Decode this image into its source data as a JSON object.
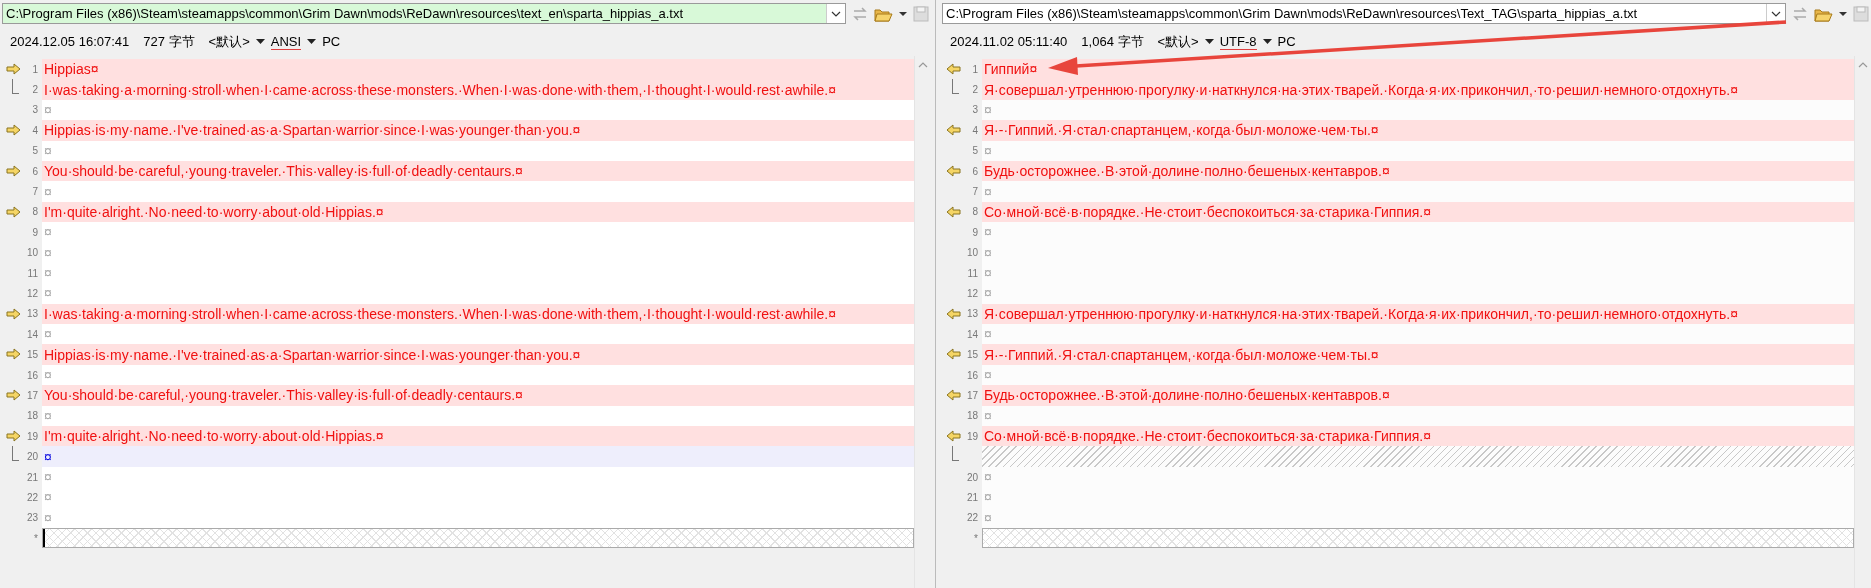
{
  "panes": [
    {
      "path": {
        "value": "C:\\Program Files (x86)\\Steam\\steamapps\\common\\Grim Dawn\\mods\\ReDawn\\resources\\text_en\\sparta_hippias_a.txt",
        "highlighted": true
      },
      "info": {
        "timestamp": "2024.12.05 16:07:41",
        "size": "727 字节",
        "format": "<默认>",
        "encoding": "ANSI",
        "line_endings": "PC"
      },
      "rows": [
        {
          "num": "1",
          "kind": "diff",
          "arrow": true,
          "bracket": false,
          "text": "Hippias¤"
        },
        {
          "num": "2",
          "kind": "diff",
          "arrow": false,
          "bracket": true,
          "text": "I·was·taking·a·morning·stroll·when·I·came·across·these·monsters.·When·I·was·done·with·them,·I·thought·I·would·rest·awhile.¤"
        },
        {
          "num": "3",
          "kind": "blank",
          "arrow": false,
          "bracket": false,
          "text": "¤"
        },
        {
          "num": "4",
          "kind": "diff",
          "arrow": true,
          "bracket": false,
          "text": "Hippias·is·my·name.·I've·trained·as·a·Spartan·warrior·since·I·was·younger·than·you.¤"
        },
        {
          "num": "5",
          "kind": "blank",
          "arrow": false,
          "bracket": false,
          "text": "¤"
        },
        {
          "num": "6",
          "kind": "diff",
          "arrow": true,
          "bracket": false,
          "text": "You·should·be·careful,·young·traveler.·This·valley·is·full·of·deadly·centaurs.¤"
        },
        {
          "num": "7",
          "kind": "blank",
          "arrow": false,
          "bracket": false,
          "text": "¤"
        },
        {
          "num": "8",
          "kind": "diff",
          "arrow": true,
          "bracket": false,
          "text": "I'm·quite·alright.·No·need·to·worry·about·old·Hippias.¤"
        },
        {
          "num": "9",
          "kind": "blank",
          "arrow": false,
          "bracket": false,
          "text": "¤"
        },
        {
          "num": "10",
          "kind": "blank",
          "arrow": false,
          "bracket": false,
          "text": "¤"
        },
        {
          "num": "11",
          "kind": "blank",
          "arrow": false,
          "bracket": false,
          "text": "¤"
        },
        {
          "num": "12",
          "kind": "blank",
          "arrow": false,
          "bracket": false,
          "text": "¤"
        },
        {
          "num": "13",
          "kind": "diff",
          "arrow": true,
          "bracket": false,
          "text": "I·was·taking·a·morning·stroll·when·I·came·across·these·monsters.·When·I·was·done·with·them,·I·thought·I·would·rest·awhile.¤"
        },
        {
          "num": "14",
          "kind": "blank",
          "arrow": false,
          "bracket": false,
          "text": "¤"
        },
        {
          "num": "15",
          "kind": "diff",
          "arrow": true,
          "bracket": false,
          "text": "Hippias·is·my·name.·I've·trained·as·a·Spartan·warrior·since·I·was·younger·than·you.¤"
        },
        {
          "num": "16",
          "kind": "blank",
          "arrow": false,
          "bracket": false,
          "text": "¤"
        },
        {
          "num": "17",
          "kind": "diff",
          "arrow": true,
          "bracket": false,
          "text": "You·should·be·careful,·young·traveler.·This·valley·is·full·of·deadly·centaurs.¤"
        },
        {
          "num": "18",
          "kind": "blank",
          "arrow": false,
          "bracket": false,
          "text": "¤"
        },
        {
          "num": "19",
          "kind": "diff",
          "arrow": true,
          "bracket": false,
          "text": "I'm·quite·alright.·No·need·to·worry·about·old·Hippias.¤"
        },
        {
          "num": "20",
          "kind": "current",
          "arrow": false,
          "bracket": true,
          "text": "¤"
        },
        {
          "num": "21",
          "kind": "blank",
          "arrow": false,
          "bracket": false,
          "text": "¤"
        },
        {
          "num": "22",
          "kind": "blank",
          "arrow": false,
          "bracket": false,
          "text": "¤"
        },
        {
          "num": "23",
          "kind": "blank",
          "arrow": false,
          "bracket": false,
          "text": "¤"
        },
        {
          "num": "*",
          "kind": "end",
          "arrow": false,
          "bracket": false,
          "cursor": true
        }
      ]
    },
    {
      "path": {
        "value": "C:\\Program Files (x86)\\Steam\\steamapps\\common\\Grim Dawn\\mods\\ReDawn\\resources\\Text_TAG\\sparta_hippias_a.txt",
        "highlighted": false
      },
      "info": {
        "timestamp": "2024.11.02 05:11:40",
        "size": "1,064 字节",
        "format": "<默认>",
        "encoding": "UTF-8",
        "line_endings": "PC"
      },
      "rows": [
        {
          "num": "1",
          "kind": "diff",
          "arrow": true,
          "bracket": false,
          "text": "Гиппий¤"
        },
        {
          "num": "2",
          "kind": "diff",
          "arrow": false,
          "bracket": true,
          "text": "Я·совершал·утреннюю·прогулку·и·наткнулся·на·этих·тварей.·Когда·я·их·прикончил,·то·решил·немного·отдохнуть.¤"
        },
        {
          "num": "3",
          "kind": "blank",
          "arrow": false,
          "bracket": false,
          "text": "¤"
        },
        {
          "num": "4",
          "kind": "diff",
          "arrow": true,
          "bracket": false,
          "text": "Я·-·Гиппий.·Я·стал·спартанцем,·когда·был·моложе·чем·ты.¤"
        },
        {
          "num": "5",
          "kind": "blank",
          "arrow": false,
          "bracket": false,
          "text": "¤"
        },
        {
          "num": "6",
          "kind": "diff",
          "arrow": true,
          "bracket": false,
          "text": "Будь·осторожнее.·В·этой·долине·полно·бешеных·кентавров.¤"
        },
        {
          "num": "7",
          "kind": "blank",
          "arrow": false,
          "bracket": false,
          "text": "¤"
        },
        {
          "num": "8",
          "kind": "diff",
          "arrow": true,
          "bracket": false,
          "text": "Со·мной·всё·в·порядке.·Не·стоит·беспокоиться·за·старика·Гиппия.¤"
        },
        {
          "num": "9",
          "kind": "blank",
          "arrow": false,
          "bracket": false,
          "text": "¤"
        },
        {
          "num": "10",
          "kind": "blank",
          "arrow": false,
          "bracket": false,
          "text": "¤"
        },
        {
          "num": "11",
          "kind": "blank",
          "arrow": false,
          "bracket": false,
          "text": "¤"
        },
        {
          "num": "12",
          "kind": "blank",
          "arrow": false,
          "bracket": false,
          "text": "¤"
        },
        {
          "num": "13",
          "kind": "diff",
          "arrow": true,
          "bracket": false,
          "text": "Я·совершал·утреннюю·прогулку·и·наткнулся·на·этих·тварей.·Когда·я·их·прикончил,·то·решил·немного·отдохнуть.¤"
        },
        {
          "num": "14",
          "kind": "blank",
          "arrow": false,
          "bracket": false,
          "text": "¤"
        },
        {
          "num": "15",
          "kind": "diff",
          "arrow": true,
          "bracket": false,
          "text": "Я·-·Гиппий.·Я·стал·спартанцем,·когда·был·моложе·чем·ты.¤"
        },
        {
          "num": "16",
          "kind": "blank",
          "arrow": false,
          "bracket": false,
          "text": "¤"
        },
        {
          "num": "17",
          "kind": "diff",
          "arrow": true,
          "bracket": false,
          "text": "Будь·осторожнее.·В·этой·долине·полно·бешеных·кентавров.¤"
        },
        {
          "num": "18",
          "kind": "blank",
          "arrow": false,
          "bracket": false,
          "text": "¤"
        },
        {
          "num": "19",
          "kind": "diff",
          "arrow": true,
          "bracket": false,
          "text": "Со·мной·всё·в·порядке.·Не·стоит·беспокоиться·за·старика·Гиппия.¤"
        },
        {
          "kind": "gap",
          "arrow": false,
          "bracket": true
        },
        {
          "num": "20",
          "kind": "blank",
          "arrow": false,
          "bracket": false,
          "text": "¤"
        },
        {
          "num": "21",
          "kind": "blank",
          "arrow": false,
          "bracket": false,
          "text": "¤"
        },
        {
          "num": "22",
          "kind": "blank",
          "arrow": false,
          "bracket": false,
          "text": "¤"
        },
        {
          "num": "*",
          "kind": "end",
          "arrow": false,
          "bracket": false,
          "cursor": false
        }
      ]
    }
  ],
  "annotation": {
    "kind": "arrow"
  }
}
